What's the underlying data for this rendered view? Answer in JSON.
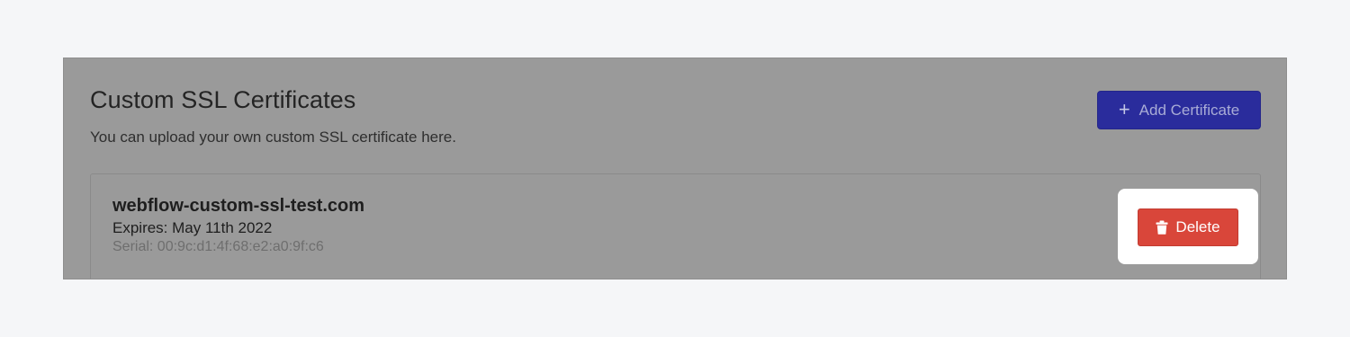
{
  "section": {
    "title": "Custom SSL Certificates",
    "subtitle": "You can upload your own custom SSL certificate here.",
    "add_button_label": "Add Certificate",
    "add_button_icon": "plus-icon"
  },
  "certificate": {
    "domain": "webflow-custom-ssl-test.com",
    "expires": "Expires: May 11th 2022",
    "serial": "Serial: 00:9c:d1:4f:68:e2:a0:9f:c6",
    "delete_label": "Delete",
    "delete_icon": "trash-icon"
  },
  "colors": {
    "page_background": "#f5f6f8",
    "overlay_panel": "#9a9a9a",
    "primary_button": "#2a2c9c",
    "danger_button": "#d9463a",
    "highlight": "#ffffff"
  }
}
